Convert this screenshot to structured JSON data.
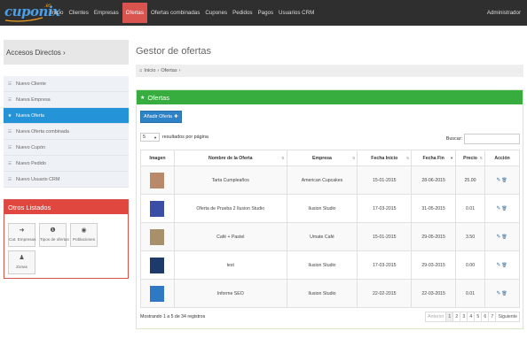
{
  "brand": {
    "name": "cuponix",
    "sup": ".es"
  },
  "nav": {
    "items": [
      "Inicio",
      "Clientes",
      "Empresas",
      "Ofertas",
      "Ofertas combinadas",
      "Cupones",
      "Pedidos",
      "Pagos",
      "Usuarios CRM"
    ],
    "active": "Ofertas",
    "user": "Administrador"
  },
  "sidebar": {
    "heading": "Accesos Directos ›",
    "items": [
      {
        "label": "Nuevo Cliente",
        "icon": "list-icon"
      },
      {
        "label": "Nueva Empresa",
        "icon": "list-icon"
      },
      {
        "label": "Nueva Oferta",
        "icon": "star-icon",
        "active": true
      },
      {
        "label": "Nueva Oferta combinada",
        "icon": "list-icon"
      },
      {
        "label": "Nuevo Cupón",
        "icon": "list-icon"
      },
      {
        "label": "Nuevo Pedido",
        "icon": "list-icon"
      },
      {
        "label": "Nuevo Usuario CRM",
        "icon": "list-icon"
      }
    ]
  },
  "otros": {
    "heading": "Otros Listados",
    "tiles": [
      {
        "label": "Cat. Empresas",
        "icon": "arrow-right-icon",
        "glyph": "➜"
      },
      {
        "label": "Tipos de ofertas",
        "icon": "info-icon",
        "glyph": "❶"
      },
      {
        "label": "Poblaciones",
        "icon": "location-icon",
        "glyph": "◉"
      },
      {
        "label": "Zonas",
        "icon": "pin-icon",
        "glyph": "♟"
      }
    ]
  },
  "main": {
    "title": "Gestor de ofertas",
    "breadcrumb": [
      "Inicio",
      "Ofertas"
    ]
  },
  "panel": {
    "title": "Ofertas",
    "add_button": "Añadir Oferta",
    "length_value": "5",
    "length_suffix": "resultados por página",
    "search_label": "Buscar:",
    "search_value": "",
    "columns": [
      "Imagen",
      "Nombre de la Oferta",
      "Empresa",
      "Fecha Inicio",
      "Fecha Fin",
      "Precio",
      "Acción"
    ],
    "rows": [
      {
        "nombre": "Tarta Cumpleaños",
        "empresa": "American Cupcakes",
        "inicio": "15-01-2015",
        "fin": "28-06-2015",
        "precio": "25.00",
        "thumb": "#b98a6a"
      },
      {
        "nombre": "Oferta de Prueba 2 Ilusion Studio",
        "empresa": "Ilusion Studio",
        "inicio": "17-03-2015",
        "fin": "31-05-2015",
        "precio": "0.01",
        "thumb": "#3a4ea8"
      },
      {
        "nombre": "Café + Pastel",
        "empresa": "Umate Café",
        "inicio": "15-01-2015",
        "fin": "29-05-2015",
        "precio": "3.50",
        "thumb": "#a8916a"
      },
      {
        "nombre": "test",
        "empresa": "Ilusion Studio",
        "inicio": "17-03-2015",
        "fin": "29-03-2015",
        "precio": "0.00",
        "thumb": "#1e3a6a"
      },
      {
        "nombre": "Informe SEO",
        "empresa": "Ilusion Studio",
        "inicio": "22-02-2015",
        "fin": "22-03-2015",
        "precio": "0.01",
        "thumb": "#2f78c4"
      }
    ],
    "info": "Mostrando 1 a 5 de 34 registros",
    "pager": {
      "prev": "Anterior",
      "pages": [
        "1",
        "2",
        "3",
        "4",
        "5",
        "6",
        "7"
      ],
      "active": "1",
      "next": "Siguiente"
    }
  },
  "colors": {
    "nav_bg": "#2f2f2f",
    "active_nav": "#d9534f",
    "primary": "#2493d8",
    "panel_head": "#37ad3f",
    "otros_head": "#e0473f"
  }
}
